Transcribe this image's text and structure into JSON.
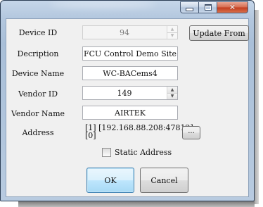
{
  "window": {
    "caption_buttons": {
      "minimize": "minimize-icon",
      "maximize": "maximize-icon",
      "close": "close-icon",
      "close_glyph": "✕"
    },
    "accent_close": "#c7462a"
  },
  "form": {
    "device_id": {
      "label": "Device ID",
      "value": "94"
    },
    "description": {
      "label": "Decription",
      "value": "FCU Control Demo Site"
    },
    "device_name": {
      "label": "Device Name",
      "value": "WC-BACems4"
    },
    "vendor_id": {
      "label": "Vendor ID",
      "value": "149"
    },
    "vendor_name": {
      "label": "Vendor Name",
      "value": "AIRTEK"
    },
    "address": {
      "label": "Address",
      "line1": "[1] [192.168.88.208:47812]",
      "line2": "[0]"
    },
    "static_address": {
      "label": "Static Address",
      "checked": false
    }
  },
  "buttons": {
    "update_from": "Update From",
    "browse": "...",
    "ok": "OK",
    "cancel": "Cancel"
  }
}
